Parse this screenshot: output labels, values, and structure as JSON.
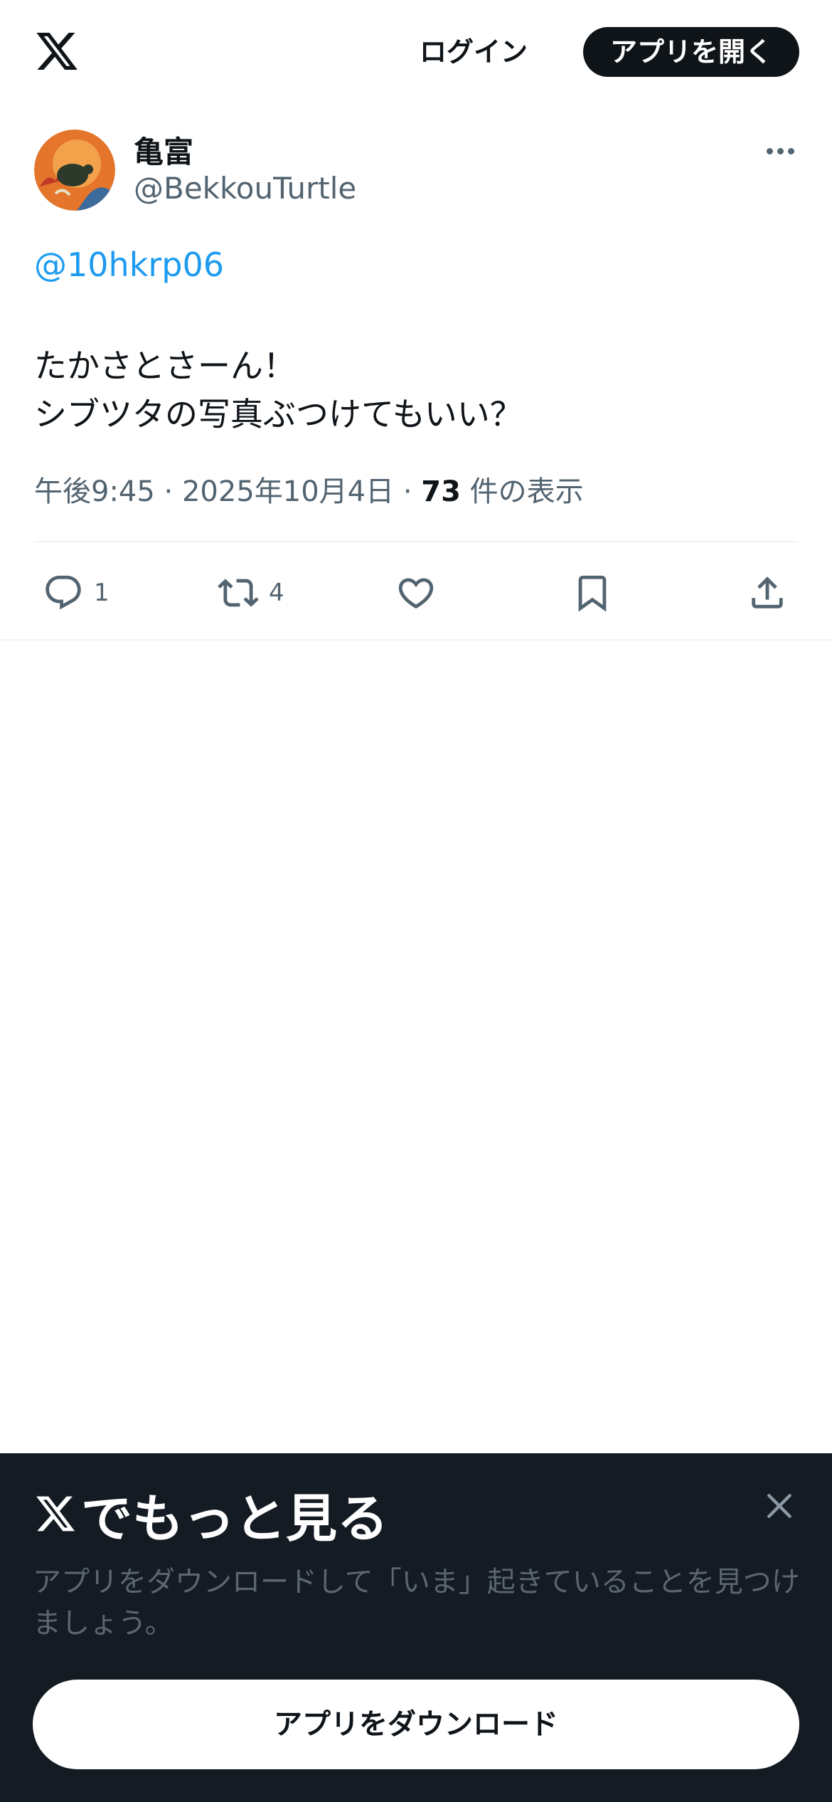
{
  "header": {
    "logo": "x-logo-icon",
    "login_label": "ログイン",
    "open_app_label": "アプリを開く"
  },
  "tweet": {
    "author": {
      "display_name": "亀富",
      "handle": "@BekkouTurtle",
      "avatar_icon": "turtle-avatar"
    },
    "mention": "@10hkrp06",
    "text_lines": [
      "たかさとさーん！",
      "シブツタの写真ぶつけてもいい？"
    ],
    "timestamp": "午後9:45 · 2025年10月4日 · ",
    "views_count": "73",
    "views_label": " 件の表示",
    "actions": {
      "reply_count": "1",
      "retweet_count": "4"
    }
  },
  "bottom_sheet": {
    "title": "でもっと見る",
    "description": "アプリをダウンロードして「いま」起きていることを見つけましょう。",
    "download_label": "アプリをダウンロード"
  },
  "colors": {
    "accent": "#1d9bf0",
    "text_primary": "#0f1419",
    "text_secondary": "#536471",
    "sheet_bg": "#141b23"
  }
}
